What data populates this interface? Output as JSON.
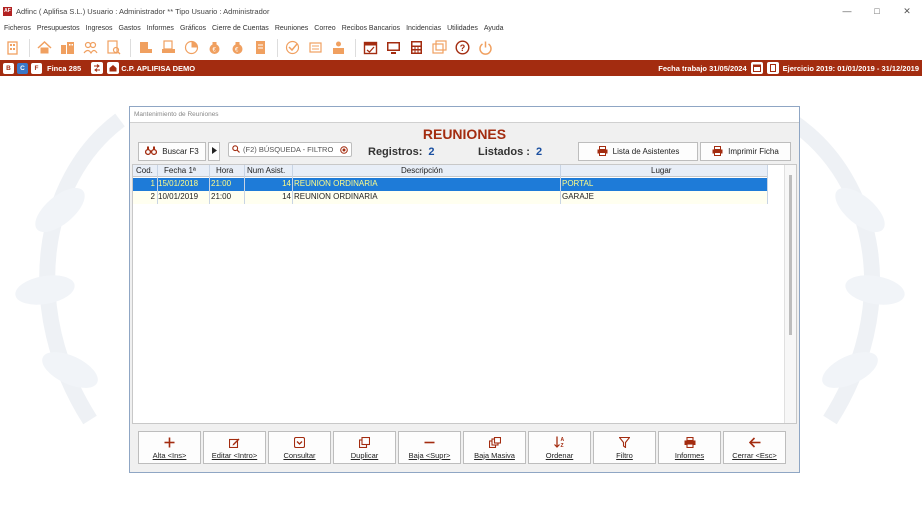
{
  "window": {
    "logo": "AF",
    "title": "Adfinc  ( Aplifisa S.L.)   Usuario : Administrador  **  Tipo Usuario : Administrador",
    "minimize": "—",
    "maximize": "□",
    "close": "✕"
  },
  "menu": [
    "Ficheros",
    "Presupuestos",
    "Ingresos",
    "Gastos",
    "Informes",
    "Gráficos",
    "Cierre de Cuentas",
    "Reuniones",
    "Correo",
    "Recibos Bancarios",
    "Incidencias",
    "Utilidades",
    "Ayuda"
  ],
  "toolbar_icons": [
    "building-icon",
    "house-icon",
    "city-icon",
    "users-icon",
    "document-search-icon",
    "book-icon",
    "printer-doc-icon",
    "chart-icon",
    "money-bag-icon",
    "coins-icon",
    "invoice-icon",
    "meeting-icon",
    "bell-icon",
    "people-icon",
    "calendar-icon",
    "monitor-icon",
    "calculator-icon",
    "window-icon",
    "help-icon",
    "power-icon"
  ],
  "infobar": {
    "badge_b": "B",
    "badge_c": "C",
    "badge_f": "F",
    "finca": "Finca 285",
    "community": "C.P. APLIFISA DEMO",
    "fecha_trabajo": "Fecha trabajo 31/05/2024",
    "ejercicio": "Ejercicio  2019: 01/01/2019 - 31/12/2019"
  },
  "dialog": {
    "title": "Mantenimiento de Reuniones",
    "heading": "REUNIONES",
    "search_button": "Buscar F3",
    "search_placeholder": "(F2) BÚSQUEDA - FILTRO",
    "registros_label": "Registros:",
    "registros_value": "2",
    "listados_label": "Listados :",
    "listados_value": "2",
    "asistentes_button": "Lista de Asistentes",
    "imprimir_button": "Imprimir Ficha"
  },
  "table": {
    "columns": [
      "Cod.",
      "Fecha 1ª",
      "Hora",
      "Num Asist.",
      "Descripción",
      "Lugar"
    ],
    "rows": [
      {
        "cod": "1",
        "fecha": "15/01/2018",
        "hora": "21:00",
        "asist": "14",
        "desc": "REUNION ORDINARIA",
        "lugar": "PORTAL"
      },
      {
        "cod": "2",
        "fecha": "10/01/2019",
        "hora": "21:00",
        "asist": "14",
        "desc": "REUNION ORDINARIA",
        "lugar": "GARAJE"
      }
    ]
  },
  "actions": {
    "alta": "Alta <Ins>",
    "editar": "Editar <Intro>",
    "consultar": "Consultar",
    "duplicar": "Duplicar",
    "baja": "Baja <Supr>",
    "baja_masiva": "Baja Masiva",
    "ordenar": "Ordenar",
    "filtro": "Filtro",
    "informes": "Informes",
    "cerrar": "Cerrar <Esc>"
  },
  "colors": {
    "brand": "#a32c10",
    "accent_orange": "#f0a060",
    "selection": "#1e7bd8",
    "count_blue": "#1a4fa0"
  }
}
